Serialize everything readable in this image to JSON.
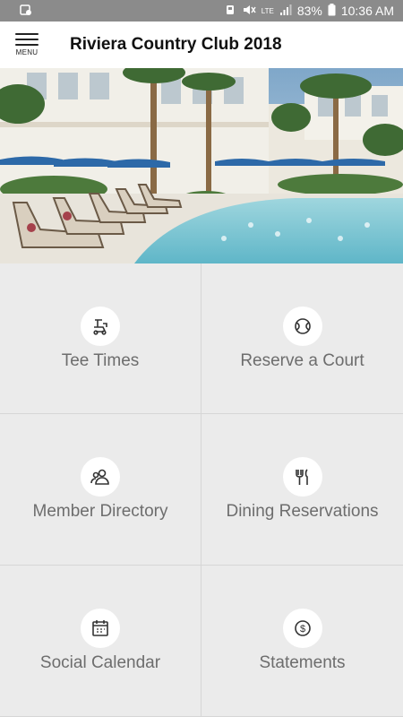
{
  "status_bar": {
    "battery": "83%",
    "time": "10:36 AM",
    "network": "LTE",
    "icons": [
      "notification-icon",
      "vibrate-icon",
      "mute-icon",
      "signal-icon",
      "battery-icon"
    ]
  },
  "app_bar": {
    "menu_label": "MENU",
    "title": "Riviera Country Club 2018"
  },
  "hero": {
    "description_icon": "resort-pool-photo"
  },
  "tiles": [
    {
      "label": "Tee Times",
      "icon": "golf-cart-icon"
    },
    {
      "label": "Reserve a Court",
      "icon": "tennis-ball-icon"
    },
    {
      "label": "Member Directory",
      "icon": "people-icon"
    },
    {
      "label": "Dining Reservations",
      "icon": "fork-knife-icon"
    },
    {
      "label": "Social Calendar",
      "icon": "calendar-icon"
    },
    {
      "label": "Statements",
      "icon": "dollar-icon"
    }
  ],
  "colors": {
    "status_bar_bg": "#8b8b8b",
    "tile_bg": "#ebebeb",
    "tile_label": "#6d6d6d"
  }
}
